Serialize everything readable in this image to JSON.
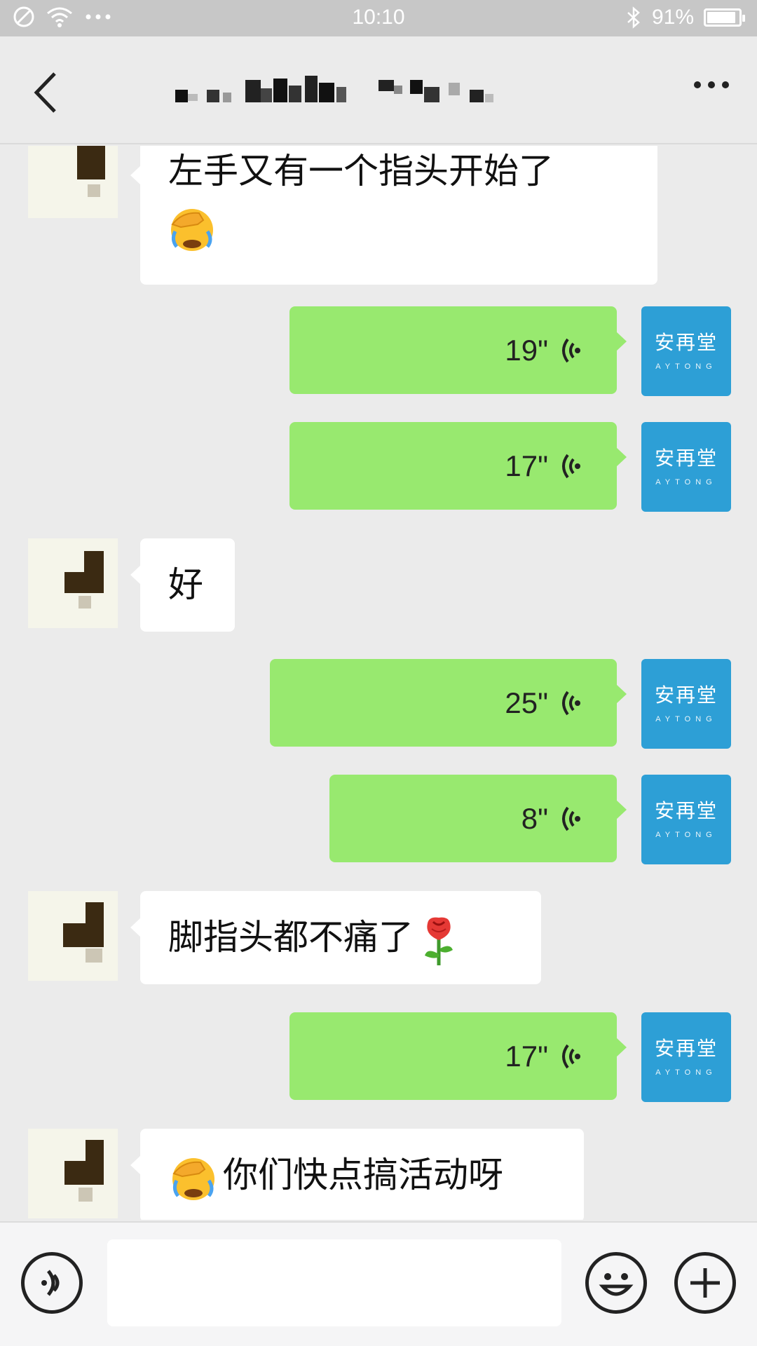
{
  "status_bar": {
    "time": "10:10",
    "battery_text": "91%",
    "battery_level": 0.91
  },
  "header": {
    "back_icon": "chevron-left-icon",
    "more_icon": "more-horizontal-icon"
  },
  "brand": {
    "avatar_cn": "安再堂",
    "avatar_en": "AYTONG",
    "avatar_color": "#2d9fd6"
  },
  "messages": [
    {
      "id": "m1",
      "direction": "incoming",
      "type": "text",
      "text": "左手又有一个指头开始了",
      "emoji": "facepalm"
    },
    {
      "id": "m2",
      "direction": "outgoing",
      "type": "voice",
      "duration": "19\""
    },
    {
      "id": "m3",
      "direction": "outgoing",
      "type": "voice",
      "duration": "17\""
    },
    {
      "id": "m4",
      "direction": "incoming",
      "type": "text",
      "text": "好"
    },
    {
      "id": "m5",
      "direction": "outgoing",
      "type": "voice",
      "duration": "25\""
    },
    {
      "id": "m6",
      "direction": "outgoing",
      "type": "voice",
      "duration": "8\""
    },
    {
      "id": "m7",
      "direction": "incoming",
      "type": "text",
      "text": "脚指头都不痛了",
      "emoji": "rose"
    },
    {
      "id": "m8",
      "direction": "outgoing",
      "type": "voice",
      "duration": "17\""
    },
    {
      "id": "m9",
      "direction": "incoming",
      "type": "text",
      "text": "你们快点搞活动呀",
      "emoji": "facepalm"
    }
  ],
  "input_bar": {
    "voice_icon": "voice-input-icon",
    "emoji_icon": "smiley-icon",
    "plus_icon": "plus-icon",
    "text_value": ""
  },
  "colors": {
    "outgoing_bubble": "#98e96f",
    "incoming_bubble": "#ffffff",
    "background": "#ebebeb"
  }
}
